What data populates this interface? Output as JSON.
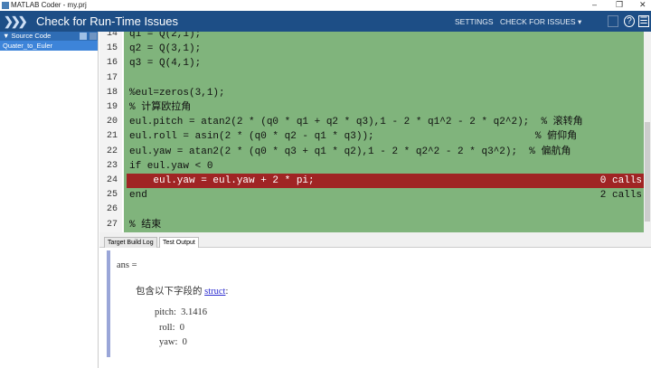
{
  "window": {
    "title": "MATLAB Coder - my.prj",
    "minimize": "–",
    "maximize": "❐",
    "close": "✕"
  },
  "toolbar": {
    "title": "Check for Run-Time Issues",
    "settings": "SETTINGS",
    "check": "CHECK FOR ISSUES ▾",
    "save_icon": "floppy-icon",
    "help_icon": "?",
    "menu_icon": "☰"
  },
  "sidebar": {
    "header": "▼ Source Code",
    "items": [
      {
        "label": "Quater_to_Euler"
      }
    ]
  },
  "code": {
    "lines": [
      {
        "num": "14",
        "code": "q1 = Q(2,1);",
        "calls": ""
      },
      {
        "num": "15",
        "code": "q2 = Q(3,1);",
        "calls": ""
      },
      {
        "num": "16",
        "code": "q3 = Q(4,1);",
        "calls": ""
      },
      {
        "num": "17",
        "code": "",
        "calls": ""
      },
      {
        "num": "18",
        "code": "%eul=zeros(3,1);",
        "calls": ""
      },
      {
        "num": "19",
        "code": "% 计算欧拉角",
        "calls": ""
      },
      {
        "num": "20",
        "code": "eul.pitch = atan2(2 * (q0 * q1 + q2 * q3),1 - 2 * q1^2 - 2 * q2^2);  % 滚转角",
        "calls": ""
      },
      {
        "num": "21",
        "code": "eul.roll = asin(2 * (q0 * q2 - q1 * q3));                           % 俯仰角",
        "calls": ""
      },
      {
        "num": "22",
        "code": "eul.yaw = atan2(2 * (q0 * q3 + q1 * q2),1 - 2 * q2^2 - 2 * q3^2);  % 偏航角",
        "calls": ""
      },
      {
        "num": "23",
        "code": "if eul.yaw < 0",
        "calls": ""
      },
      {
        "num": "24",
        "code": "    eul.yaw = eul.yaw + 2 * pi;",
        "calls": "0 calls",
        "highlight": true
      },
      {
        "num": "25",
        "code": "end",
        "calls": "2 calls"
      },
      {
        "num": "26",
        "code": "",
        "calls": ""
      },
      {
        "num": "27",
        "code": "% 结束",
        "calls": ""
      }
    ]
  },
  "tabs": [
    {
      "label": "Target Build Log"
    },
    {
      "label": "Test Output",
      "active": true
    }
  ],
  "output": {
    "ans": "ans =",
    "desc": "包含以下字段的 ",
    "link": "struct",
    "colon": ":",
    "fields": [
      "pitch:  3.1416",
      "roll:  0",
      "yaw:  0"
    ]
  }
}
